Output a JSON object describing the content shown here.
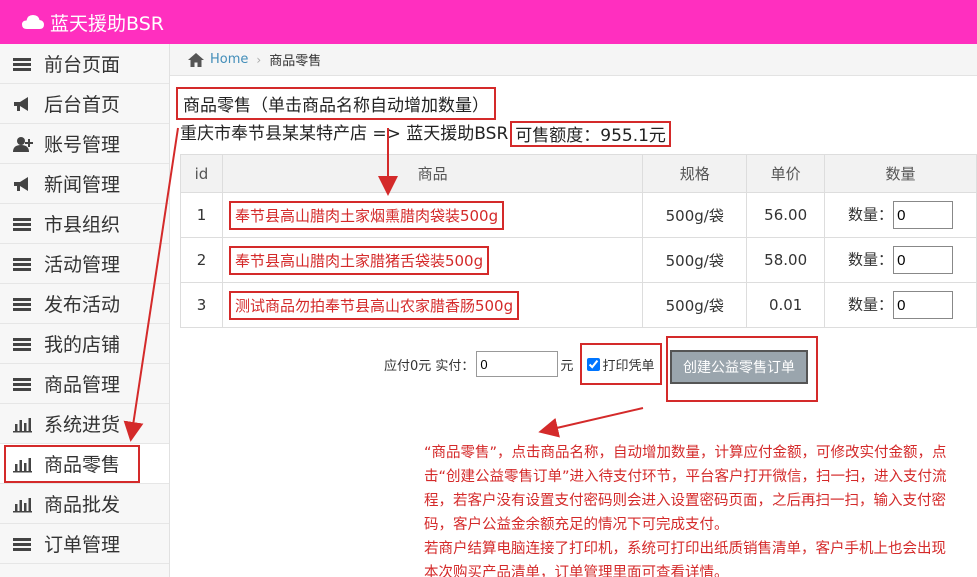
{
  "header": {
    "brand": "蓝天援助BSR",
    "accent": "#ff2fbf"
  },
  "sidebar": {
    "items": [
      {
        "label": "前台页面",
        "icon": "list-icon"
      },
      {
        "label": "后台首页",
        "icon": "bullhorn-icon"
      },
      {
        "label": "账号管理",
        "icon": "user-add-icon"
      },
      {
        "label": "新闻管理",
        "icon": "bullhorn-icon"
      },
      {
        "label": "市县组织",
        "icon": "list-icon"
      },
      {
        "label": "活动管理",
        "icon": "list-icon"
      },
      {
        "label": "发布活动",
        "icon": "list-icon"
      },
      {
        "label": "我的店铺",
        "icon": "list-icon"
      },
      {
        "label": "商品管理",
        "icon": "list-icon"
      },
      {
        "label": "系统进货",
        "icon": "bar-chart-icon"
      },
      {
        "label": "商品零售",
        "icon": "bar-chart-icon",
        "active": true
      },
      {
        "label": "商品批发",
        "icon": "bar-chart-icon"
      },
      {
        "label": "订单管理",
        "icon": "list-icon"
      }
    ]
  },
  "breadcrumb": {
    "home": "Home",
    "current": "商品零售"
  },
  "page": {
    "title": "商品零售（单击商品名称自动增加数量）",
    "shop_route": "重庆市奉节县某某特产店 => 蓝天援助BSR",
    "quota": "可售额度：955.1元"
  },
  "table": {
    "headers": [
      "id",
      "商品",
      "规格",
      "单价",
      "数量"
    ],
    "qty_label": "数量：",
    "rows": [
      {
        "id": "1",
        "name": "奉节县高山腊肉土家烟熏腊肉袋装500g",
        "spec": "500g/袋",
        "price": "56.00",
        "qty": "0"
      },
      {
        "id": "2",
        "name": "奉节县高山腊肉土家腊猪舌袋装500g",
        "spec": "500g/袋",
        "price": "58.00",
        "qty": "0"
      },
      {
        "id": "3",
        "name": "测试商品勿拍奉节县高山农家腊香肠500g",
        "spec": "500g/袋",
        "price": "0.01",
        "qty": "0"
      }
    ]
  },
  "payment": {
    "due_label": "应付0元 实付：",
    "paid_value": "0",
    "unit": "元",
    "print_label": "打印凭单",
    "print_checked": true,
    "create_button": "创建公益零售订单"
  },
  "note": {
    "paragraph1": "“商品零售”，点击商品名称，自动增加数量，计算应付金额，可修改实付金额，点击“创建公益零售订单”进入待支付环节，平台客户打开微信，扫一扫，进入支付流程，若客户没有设置支付密码则会进入设置密码页面，之后再扫一扫，输入支付密码，客户公益金余额充足的情况下可完成支付。",
    "paragraph2": "若商户结算电脑连接了打印机，系统可打印出纸质销售清单，客户手机上也会出现本次购买产品清单，订单管理里面可查看详情。"
  }
}
